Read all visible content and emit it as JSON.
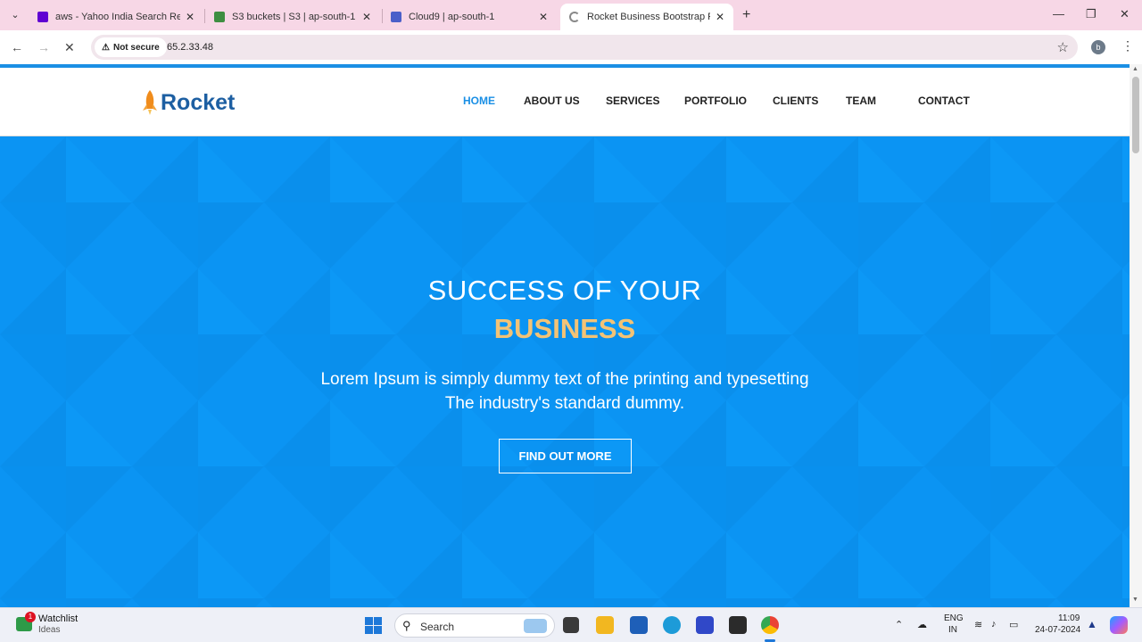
{
  "browser": {
    "tabs": [
      {
        "label": "aws - Yahoo India Search Results",
        "favicon": "yahoo-icon",
        "color": "#6001d2"
      },
      {
        "label": "S3 buckets | S3 | ap-south-1",
        "favicon": "s3-icon",
        "color": "#3e8e41"
      },
      {
        "label": "Cloud9 | ap-south-1",
        "favicon": "cloud9-icon",
        "color": "#4b5fc9"
      },
      {
        "label": "Rocket Business Bootstrap Free",
        "favicon": "loading-icon",
        "color": "#888888"
      }
    ],
    "security_label": "Not secure",
    "url": "65.2.33.48",
    "profile_initial": "b"
  },
  "site": {
    "logo_text": "Rocket",
    "nav": [
      "HOME",
      "ABOUT US",
      "SERVICES",
      "PORTFOLIO",
      "CLIENTS",
      "TEAM",
      "CONTACT"
    ],
    "active_nav": "HOME",
    "hero": {
      "title_line1": "SUCCESS OF YOUR",
      "title_line2": "BUSINESS",
      "subtitle_line1": "Lorem Ipsum is simply dummy text of the printing and typesetting",
      "subtitle_line2": "The industry's standard dummy.",
      "cta_label": "FIND OUT MORE"
    },
    "colors": {
      "accent": "#1a8fe5",
      "hero_bg": "#0b94f3",
      "highlight": "#f3c376",
      "logo": "#1d5fa2"
    }
  },
  "taskbar": {
    "widget_title": "Watchlist",
    "widget_sub": "Ideas",
    "widget_badge": "1",
    "search_placeholder": "Search",
    "lang_line1": "ENG",
    "lang_line2": "IN",
    "time": "11:09",
    "date": "24-07-2024"
  }
}
